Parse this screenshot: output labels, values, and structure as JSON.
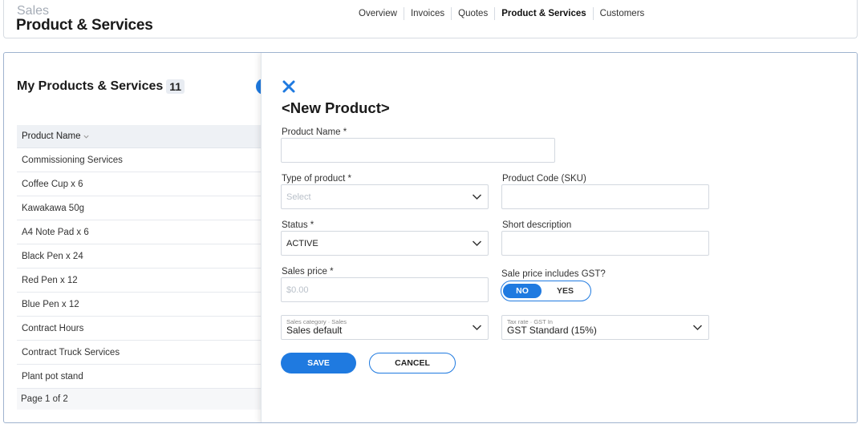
{
  "header": {
    "crumb": "Sales",
    "title": "Product & Services",
    "nav": [
      {
        "label": "Overview",
        "active": false
      },
      {
        "label": "Invoices",
        "active": false
      },
      {
        "label": "Quotes",
        "active": false
      },
      {
        "label": "Product & Services",
        "active": true
      },
      {
        "label": "Customers",
        "active": false
      }
    ]
  },
  "list": {
    "title": "My Products & Services",
    "count": "11",
    "column_header": "Product Name",
    "rows": [
      "Commissioning Services",
      "Coffee Cup x 6",
      "Kawakawa 50g",
      "A4 Note Pad x 6",
      "Black Pen x 24",
      "Red Pen x 12",
      "Blue Pen x 12",
      "Contract Hours",
      "Contract Truck Services",
      "Plant pot stand"
    ],
    "pagination": "Page 1 of 2"
  },
  "form": {
    "title": "<New Product>",
    "product_name_label": "Product Name *",
    "product_name_value": "",
    "type_label": "Type of product *",
    "type_placeholder": "Select",
    "sku_label": "Product Code (SKU)",
    "sku_value": "",
    "status_label": "Status *",
    "status_value": "ACTIVE",
    "short_desc_label": "Short description",
    "short_desc_value": "",
    "sales_price_label": "Sales price *",
    "sales_price_placeholder": "$0.00",
    "gst_label": "Sale price includes GST?",
    "gst_no": "NO",
    "gst_yes": "YES",
    "gst_selected": "NO",
    "sales_category_mini": "Sales category · Sales",
    "sales_category_value": "Sales default",
    "tax_rate_mini": "Tax rate · GST In",
    "tax_rate_value": "GST Standard (15%)",
    "save_label": "SAVE",
    "cancel_label": "CANCEL"
  },
  "colors": {
    "accent": "#1f7ae0",
    "border": "#d3d8df",
    "header_bg": "#eef1f5"
  }
}
